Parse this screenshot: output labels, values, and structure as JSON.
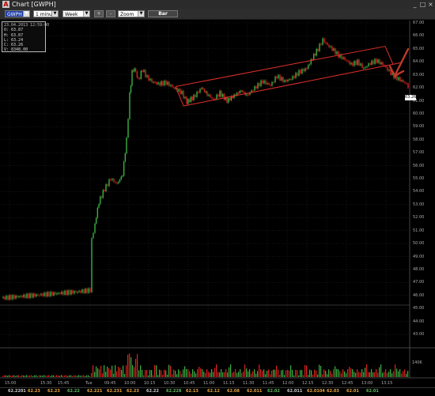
{
  "window": {
    "title": "Chart [GWPH]",
    "app_icon": "A",
    "min_label": "_",
    "max_label": "□",
    "close_label": "×"
  },
  "toolbar": {
    "symbol": "GWPH",
    "interval": "1 minute",
    "range": "Week",
    "plus_label": "+",
    "minus_label": "-",
    "zoom": "Zoom",
    "bar_label": "Bar"
  },
  "quote_panel": {
    "time": "23.04.2013 12:59:00",
    "open": "O: 63.87",
    "high": "H: 63.87",
    "low": "L: 63.24",
    "close": "C: 63.26",
    "volume": "V: 8348.00"
  },
  "price_axis": [
    "67.00",
    "66.00",
    "65.00",
    "64.00",
    "63.00",
    "62.00",
    "61.00",
    "60.00",
    "59.00",
    "58.00",
    "57.00",
    "56.00",
    "55.00",
    "54.00",
    "53.00",
    "52.00",
    "51.00",
    "50.00",
    "49.00",
    "48.00",
    "47.00",
    "46.00",
    "45.00",
    "44.00",
    "43.00"
  ],
  "last_price": "63.26",
  "volume_axis_label": "140K",
  "time_axis": [
    "15:00",
    "15:30",
    "15:45",
    "Tue",
    "09:45",
    "10:00",
    "10:15",
    "10:30",
    "10:45",
    "11:00",
    "11:15",
    "11:30",
    "11:45",
    "12:00",
    "12:15",
    "12:30",
    "12:45",
    "13:00",
    "13:15"
  ],
  "price_bar": [
    "62.2201",
    "62.23",
    "62.23",
    "62.22",
    "62.221",
    "62.231",
    "62.23",
    "62.22",
    "62.228",
    "62.13",
    "62.12",
    "62.08",
    "62.011",
    "62.02",
    "62.011",
    "62.0104",
    "62.03",
    "62.01",
    "62.01"
  ],
  "colors": {
    "up": "#3cb043",
    "down": "#d9231f",
    "channel": "#e0302a",
    "arrow": "#c0392b",
    "grid": "#2a2a2a"
  }
}
